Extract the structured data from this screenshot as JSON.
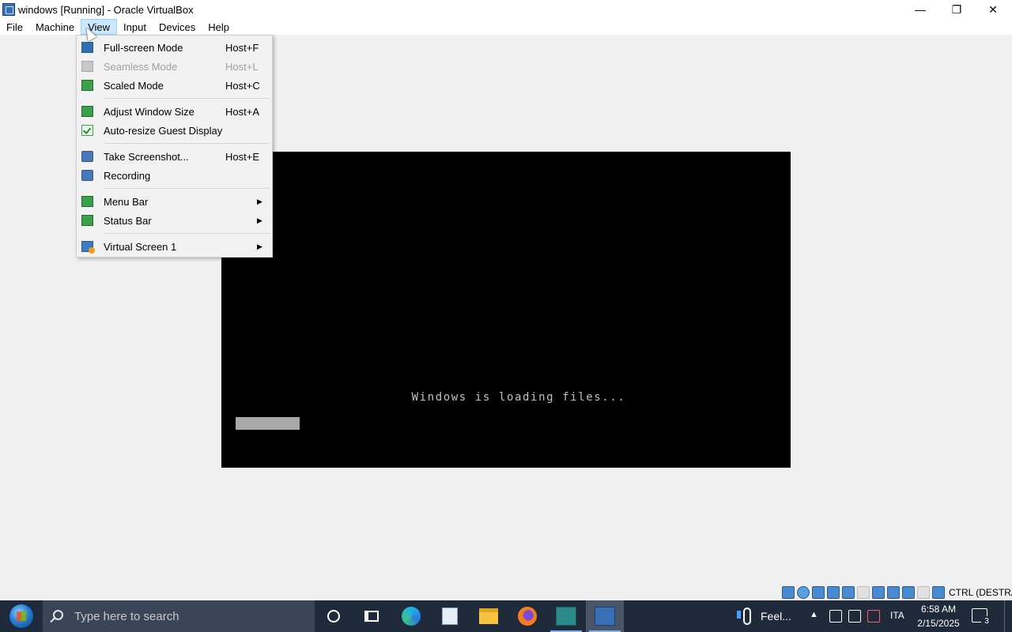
{
  "window": {
    "title": "windows [Running] - Oracle VirtualBox",
    "controls": {
      "minimize_icon": "minimize-icon",
      "restore_icon": "restore-icon",
      "close_icon": "close-icon"
    }
  },
  "menubar": {
    "items": [
      "File",
      "Machine",
      "View",
      "Input",
      "Devices",
      "Help"
    ],
    "active": "View"
  },
  "view_menu": {
    "items": [
      {
        "label": "Full-screen Mode",
        "shortcut": "Host+F",
        "icon": "fullscreen-icon",
        "enabled": true
      },
      {
        "label": "Seamless Mode",
        "shortcut": "Host+L",
        "icon": "seamless-icon",
        "enabled": false
      },
      {
        "label": "Scaled Mode",
        "shortcut": "Host+C",
        "icon": "scaled-icon",
        "enabled": true
      },
      {
        "label": "Adjust Window Size",
        "shortcut": "Host+A",
        "icon": "adjust-window-icon",
        "enabled": true
      },
      {
        "label": "Auto-resize Guest Display",
        "shortcut": "",
        "icon": "auto-resize-check-icon",
        "enabled": true,
        "checked": true
      },
      {
        "label": "Take Screenshot...",
        "shortcut": "Host+E",
        "icon": "screenshot-icon",
        "enabled": true
      },
      {
        "label": "Recording",
        "shortcut": "",
        "icon": "recording-icon",
        "enabled": true
      },
      {
        "label": "Menu Bar",
        "shortcut": "",
        "icon": "menu-bar-icon",
        "enabled": true,
        "submenu": true
      },
      {
        "label": "Status Bar",
        "shortcut": "",
        "icon": "status-bar-icon",
        "enabled": true,
        "submenu": true
      },
      {
        "label": "Virtual Screen 1",
        "shortcut": "",
        "icon": "virtual-screen-icon",
        "enabled": true,
        "submenu": true
      }
    ]
  },
  "vm_screen": {
    "message": "Windows is loading files..."
  },
  "statusbar": {
    "host_key": "CTRL (DESTRA)"
  },
  "taskbar": {
    "search_placeholder": "Type here to search",
    "weather_text": "Feel...",
    "language": "ITA",
    "time": "6:58 AM",
    "date": "2/15/2025",
    "notification_count": "3"
  },
  "colors": {
    "taskbar": "#1f2a3a",
    "menu_highlight": "#cce8ff",
    "vm_background": "#000000"
  }
}
